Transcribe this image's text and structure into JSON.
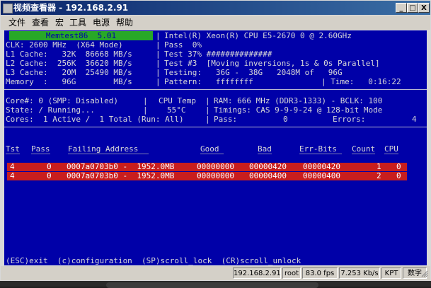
{
  "window": {
    "title": "视频查看器 - 192.168.2.91",
    "buttons": {
      "minimize": "_",
      "maximize": "□",
      "close": "X"
    }
  },
  "menu": [
    "文件",
    "查看",
    "宏",
    "工具",
    "电源",
    "帮助"
  ],
  "memtest": {
    "brand": "Memtest86  5.01",
    "left_lines": [
      "CLK: 2600 MHz  (X64 Mode)",
      "L1 Cache:   32K  86668 MB/s",
      "L2 Cache:  256K  36620 MB/s",
      "L3 Cache:   20M  25490 MB/s",
      "Memory  :   96G        MB/s"
    ],
    "right_lines": [
      "Intel(R) Xeon(R) CPU E5-2670 0 @ 2.60GHz",
      "Pass  0%",
      "Test 37% ##############",
      "Test #3  [Moving inversions, 1s & 0s Parallel]",
      "Testing:   36G -  38G   2048M of   96G",
      "Pattern:   ffffffff"
    ],
    "time_label": "| Time:   0:16:22",
    "core_lines": [
      "Core#: 0 (SMP: Disabled)",
      "State: / Running...",
      "Cores:  1 Active /  1 Total (Run: All)"
    ],
    "cpu_temp_label": "CPU Temp",
    "cpu_temp_value": "55°C",
    "ram_lines": [
      "RAM: 666 MHz (DDR3-1333) - BCLK: 100",
      "Timings: CAS 9-9-9-24 @ 128-bit Mode"
    ],
    "pass_label": "Pass:",
    "pass_value": "0",
    "errors_label": "Errors:",
    "errors_value": "4",
    "table": {
      "headers": [
        "Tst",
        "Pass",
        "Failing Address",
        "Good",
        "Bad",
        "Err-Bits",
        "Count",
        "CPU"
      ],
      "rows": [
        [
          "4",
          "0",
          "0007a0703b0 -  1952.0MB",
          "00000000",
          "00000420",
          "00000420",
          "1",
          "0"
        ],
        [
          "4",
          "0",
          "0007a0703b0 -  1952.0MB",
          "00000000",
          "00000400",
          "00000400",
          "2",
          "0"
        ]
      ]
    },
    "keys_line": "(ESC)exit  (c)configuration  (SP)scroll_lock  (CR)scroll_unlock"
  },
  "status": {
    "ip": "192.168.2.91",
    "user": "root",
    "fps": "83.0 fps",
    "rate": "7.253 Kb/s",
    "kbd": "KPT",
    "mode": "数字"
  }
}
